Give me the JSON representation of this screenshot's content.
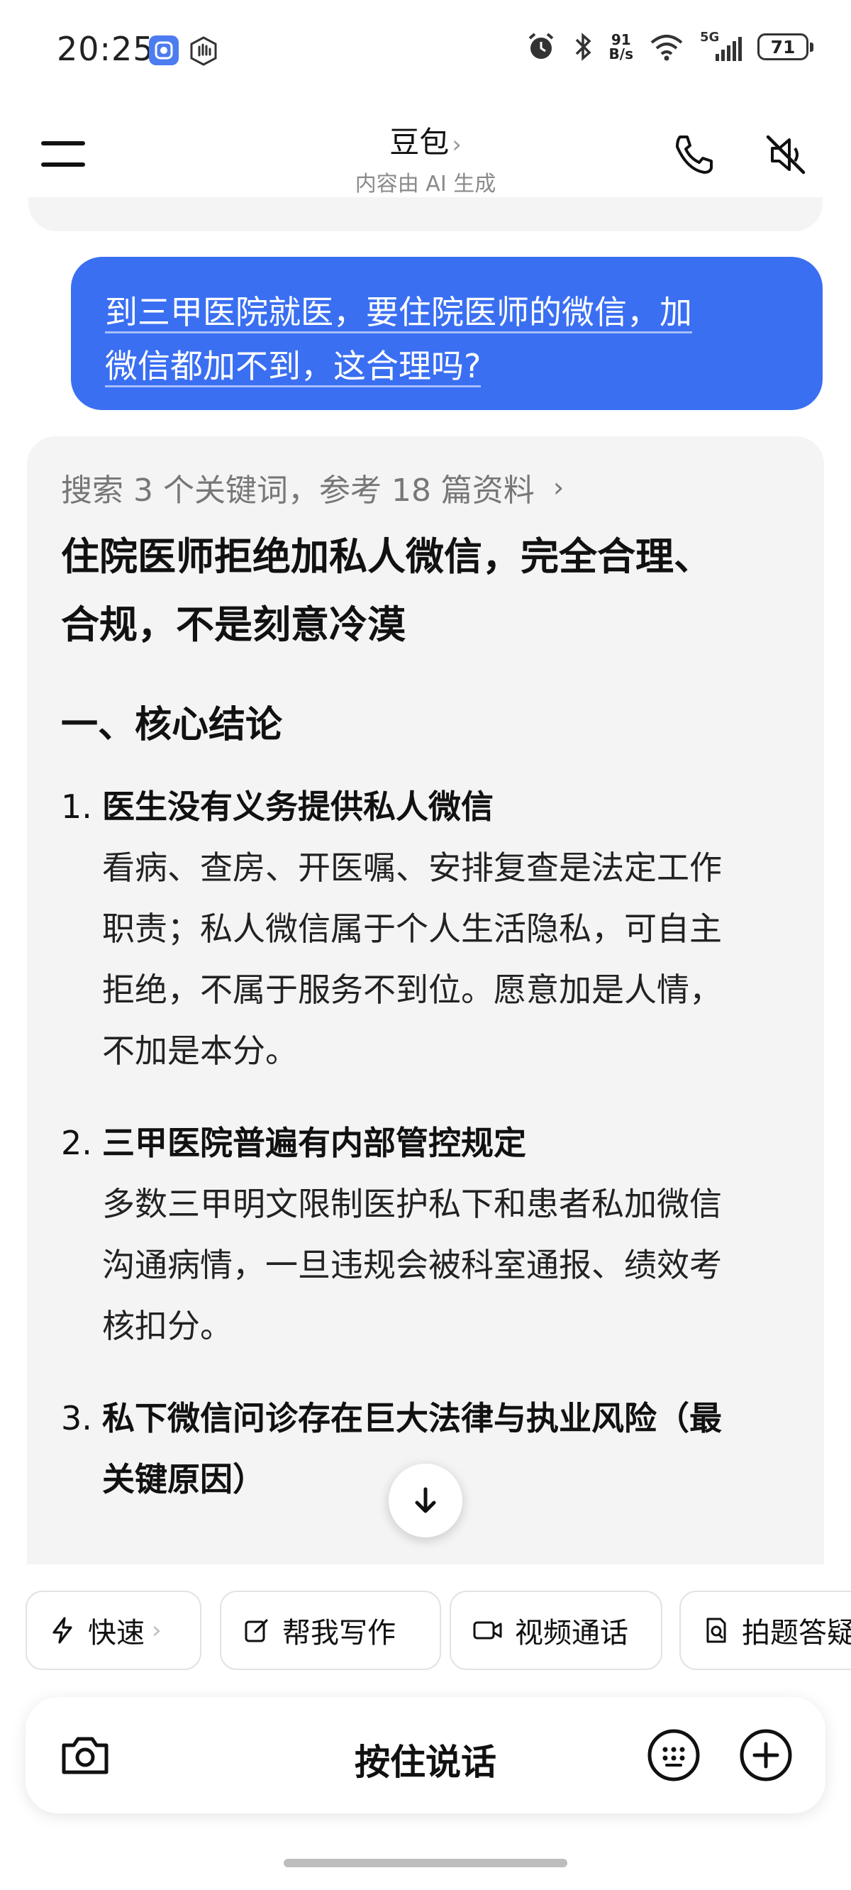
{
  "status_bar": {
    "time": "20:25",
    "net_speed_value": "91",
    "net_speed_unit": "B/s",
    "network_type": "5G",
    "battery": "71",
    "icons": [
      "app-shield-icon",
      "hand-icon",
      "alarm-icon",
      "bluetooth-icon",
      "wifi-icon",
      "signal-icon",
      "battery-icon"
    ]
  },
  "header": {
    "title": "豆包",
    "title_chevron": "›",
    "subtitle": "内容由 AI 生成",
    "icons": [
      "menu-icon",
      "phone-icon",
      "speaker-mute-icon"
    ]
  },
  "user_message": {
    "line1": "到三甲医院就医，要住院医师的微信，加",
    "line2": "微信都加不到，这合理吗?"
  },
  "ai_response": {
    "search_ref": "搜索 3 个关键词，参考 18 篇资料",
    "search_ref_chevron": "›",
    "title_line1": "住院医师拒绝加私人微信，完全合理、",
    "title_line2": "合规，不是刻意冷漠",
    "section_heading": "一、核心结论",
    "items": [
      {
        "num": "1.",
        "title": "医生没有义务提供私人微信",
        "body_lines": [
          "看病、查房、开医嘱、安排复查是法定工作",
          "职责；私人微信属于个人生活隐私，可自主",
          "拒绝，不属于服务不到位。愿意加是人情，",
          "不加是本分。"
        ]
      },
      {
        "num": "2.",
        "title": "三甲医院普遍有内部管控规定",
        "body_lines": [
          "多数三甲明文限制医护私下和患者私加微信",
          "沟通病情，一旦违规会被科室通报、绩效考",
          "核扣分。"
        ]
      },
      {
        "num": "3.",
        "title_line1": "私下微信问诊存在巨大法律与执业风险（最",
        "title_line2": "关键原因）"
      }
    ]
  },
  "quick_actions": [
    {
      "label": "快速",
      "icon": "lightning-icon",
      "chevron": "›"
    },
    {
      "label": "帮我写作",
      "icon": "edit-icon"
    },
    {
      "label": "视频通话",
      "icon": "video-icon"
    },
    {
      "label": "拍题答疑",
      "icon": "scan-doc-icon"
    }
  ],
  "input_bar": {
    "hold_to_talk": "按住说话",
    "icons": [
      "camera-icon",
      "keyboard-icon",
      "plus-icon"
    ]
  },
  "colors": {
    "accent": "#3a6ff2",
    "card_bg": "#f4f4f4",
    "muted_text": "#777777"
  }
}
